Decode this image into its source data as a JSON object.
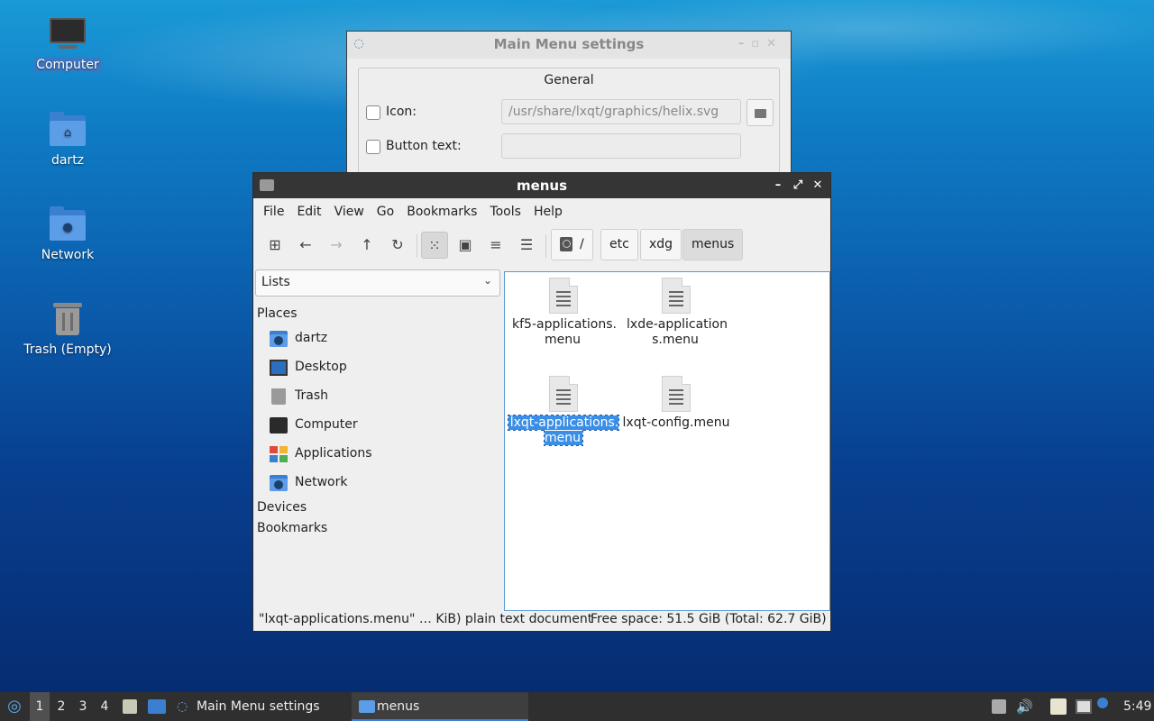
{
  "desktop": {
    "icons": [
      {
        "label": "Computer",
        "icon": "computer-icon"
      },
      {
        "label": "dartz",
        "icon": "home-folder-icon"
      },
      {
        "label": "Network",
        "icon": "network-folder-icon"
      },
      {
        "label": "Trash (Empty)",
        "icon": "trash-icon"
      }
    ]
  },
  "settings_window": {
    "title": "Main Menu settings",
    "group_title": "General",
    "icon_label": "Icon:",
    "icon_path": "/usr/share/lxqt/graphics/helix.svg",
    "button_text_label": "Button text:",
    "button_text_value": ""
  },
  "file_manager": {
    "title": "menus",
    "menu": [
      "File",
      "Edit",
      "View",
      "Go",
      "Bookmarks",
      "Tools",
      "Help"
    ],
    "breadcrumb": [
      "/",
      "etc",
      "xdg",
      "menus"
    ],
    "side_select": "Lists",
    "places_header": "Places",
    "places": [
      {
        "label": "dartz",
        "icon": "home-folder-icon"
      },
      {
        "label": "Desktop",
        "icon": "desktop-icon"
      },
      {
        "label": "Trash",
        "icon": "trash-icon"
      },
      {
        "label": "Computer",
        "icon": "computer-icon"
      },
      {
        "label": "Applications",
        "icon": "applications-icon"
      },
      {
        "label": "Network",
        "icon": "network-folder-icon"
      }
    ],
    "devices_header": "Devices",
    "bookmarks_header": "Bookmarks",
    "files": [
      {
        "name": "kf5-applications.menu",
        "selected": false
      },
      {
        "name": "lxde-applications.menu",
        "selected": false
      },
      {
        "name": "lxqt-applications.menu",
        "selected": true
      },
      {
        "name": "lxqt-config.menu",
        "selected": false
      }
    ],
    "status_left": "\"lxqt-applications.menu\" … KiB) plain text document",
    "status_right": "Free space: 51.5 GiB (Total: 62.7 GiB)"
  },
  "taskbar": {
    "desktops": [
      "1",
      "2",
      "3",
      "4"
    ],
    "current_desktop": "1",
    "tasks": [
      {
        "label": "Main Menu settings",
        "active": false
      },
      {
        "label": "menus",
        "active": true
      }
    ],
    "clock": "5:49"
  },
  "colors": {
    "accent": "#3a8ee6",
    "titlebar_active": "#353535",
    "taskbar": "#2f2f2f"
  }
}
